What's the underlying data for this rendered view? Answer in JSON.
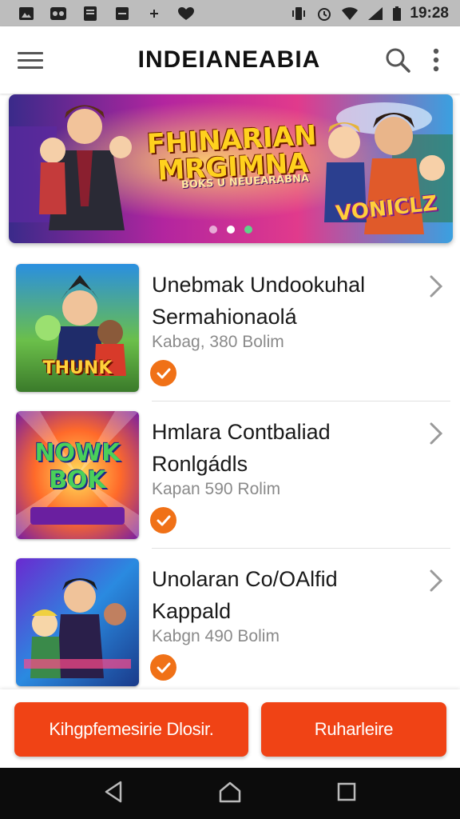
{
  "status_bar": {
    "time": "19:28",
    "left_icons": [
      "image-icon",
      "game-icon",
      "document-icon",
      "minus-icon",
      "plus-icon",
      "heart-icon"
    ],
    "right_icons": [
      "vibrate-icon",
      "alarm-icon",
      "wifi-icon",
      "signal-icon",
      "battery-icon"
    ]
  },
  "app_bar": {
    "title": "INDEIANEABIA"
  },
  "banner": {
    "title_line1": "FHINARIAN",
    "title_line2": "MRGIMNA",
    "subtitle": "BOKS U NEUEARABNA",
    "logo": "VONICLZ",
    "slide_count": 3,
    "active_slide": 2
  },
  "items": [
    {
      "title_line1": "Unebmak Undookuhal",
      "title_line2": "Sermahionaolá",
      "meta": "Kabag, 380 Bolim",
      "thumb_text": "THUNK"
    },
    {
      "title_line1": "Hmlara Contbaliad",
      "title_line2": "Ronlgádls",
      "meta": "Kapan 590 Rolim",
      "thumb_text": "NOWK BOK"
    },
    {
      "title_line1": "Unolaran Co/OAlfid",
      "title_line2": "Kappald",
      "meta": "Kabgn 490 Bolim",
      "thumb_text": ""
    }
  ],
  "buttons": {
    "primary": "Kihgpfemesirie Dlosir.",
    "secondary": "Ruharleire"
  },
  "colors": {
    "accent": "#f04315",
    "check": "#f07117",
    "nav_bar": "#0c0c0c",
    "status_bar": "#bdbdbd"
  }
}
